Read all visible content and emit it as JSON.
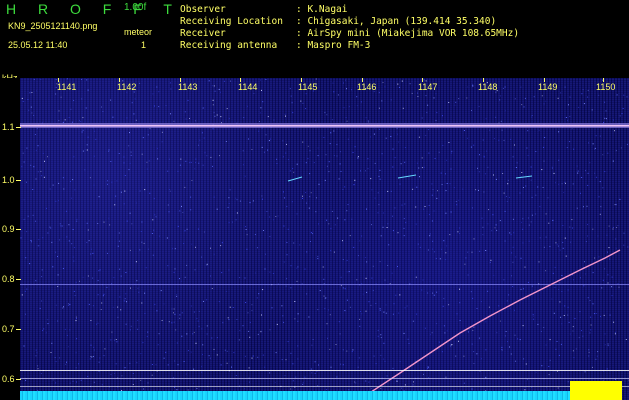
{
  "header": {
    "title": "H R O F F T",
    "fps": "1.00f",
    "filename": "KN9_2505121140.png",
    "date": "25.05.12 11:40",
    "meteor_label": "meteor",
    "meteor_count": "1",
    "info": [
      {
        "key": "Observer",
        "value": ": K.Nagai"
      },
      {
        "key": "Receiving Location",
        "value": ": Chigasaki, Japan (139.414 35.340)"
      },
      {
        "key": "Receiver",
        "value": ": AirSpy mini (Miakejima VOR 108.65MHz)"
      },
      {
        "key": "Receiving antenna",
        "value": ": Maspro FM-3"
      }
    ]
  },
  "axes": {
    "y_unit": "kHz",
    "y_ticks": [
      "1.1",
      "1.0",
      "0.9",
      "0.8",
      "0.7",
      "0.6"
    ],
    "x_ticks": [
      "1141",
      "1142",
      "1143",
      "1144",
      "1145",
      "1146",
      "1147",
      "1148",
      "1149",
      "1150"
    ]
  },
  "colors": {
    "background": "#101266",
    "text": "#ffff66",
    "title": "#3ddc3d",
    "bottom_level": "#19d4ff",
    "bottom_highlight": "#ffff00"
  }
}
